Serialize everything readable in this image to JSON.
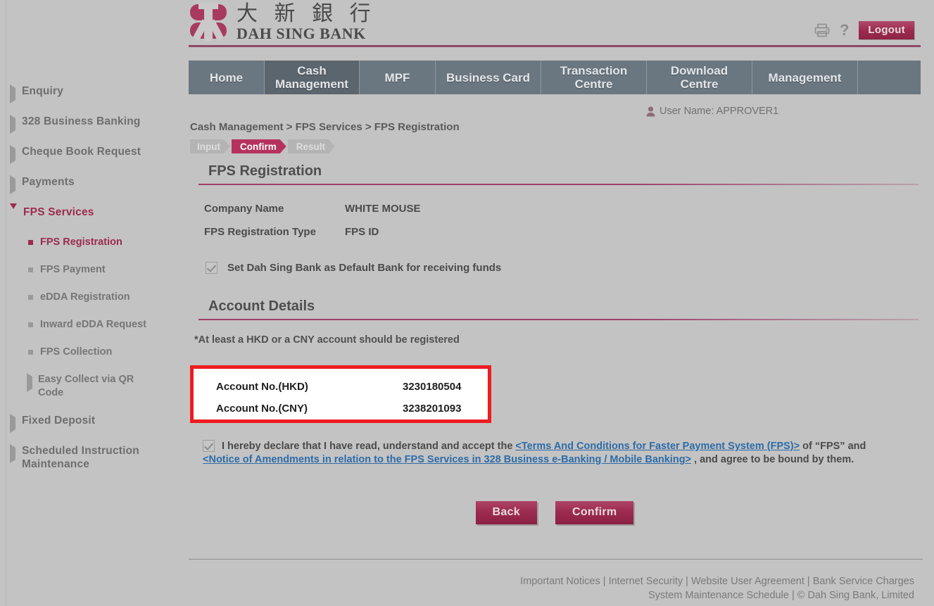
{
  "brand": {
    "name_cn": "大 新 銀 行",
    "name_en": "DAH SING BANK",
    "accent": "#9c2b4e",
    "logo_icon": "dah-sing-bank-logo"
  },
  "header": {
    "print_icon": "printer-icon",
    "help_icon": "question-mark-icon",
    "logout_label": "Logout"
  },
  "nav": {
    "tabs": [
      {
        "label": "Home",
        "active": false
      },
      {
        "label": "Cash Management",
        "active": true
      },
      {
        "label": "MPF",
        "active": false
      },
      {
        "label": "Business Card",
        "active": false
      },
      {
        "label": "Transaction Centre",
        "active": false
      },
      {
        "label": "Download Centre",
        "active": false
      },
      {
        "label": "Management",
        "active": false
      }
    ]
  },
  "user": {
    "icon": "user-icon",
    "label": "User Name: APPROVER1"
  },
  "sidebar": {
    "items": [
      {
        "label": "Enquiry",
        "level": "top",
        "expanded": false
      },
      {
        "label": "328 Business Banking",
        "level": "top",
        "expanded": false
      },
      {
        "label": "Cheque Book Request",
        "level": "top",
        "expanded": false
      },
      {
        "label": "Payments",
        "level": "top",
        "expanded": false
      },
      {
        "label": "FPS Services",
        "level": "top",
        "expanded": true
      },
      {
        "label": "FPS Registration",
        "level": "sub",
        "active": true
      },
      {
        "label": "FPS Payment",
        "level": "sub",
        "active": false
      },
      {
        "label": "eDDA Registration",
        "level": "sub",
        "active": false
      },
      {
        "label": "Inward eDDA Request",
        "level": "sub",
        "active": false
      },
      {
        "label": "FPS Collection",
        "level": "sub",
        "active": false
      },
      {
        "label": "Easy Collect via QR Code",
        "level": "sub-arrow",
        "active": false
      },
      {
        "label": "Fixed Deposit",
        "level": "top",
        "expanded": false
      },
      {
        "label": "Scheduled Instruction Maintenance",
        "level": "top",
        "expanded": false
      }
    ]
  },
  "breadcrumb": "Cash Management > FPS Services > FPS Registration",
  "steps": [
    {
      "label": "Input",
      "active": false
    },
    {
      "label": "Confirm",
      "active": true
    },
    {
      "label": "Result",
      "active": false
    }
  ],
  "main": {
    "section1_title": "FPS Registration",
    "fields": [
      {
        "label": "Company Name",
        "value": "WHITE MOUSE"
      },
      {
        "label": "FPS Registration Type",
        "value": "FPS ID"
      }
    ],
    "default_bank": {
      "checked": true,
      "label": "Set Dah Sing Bank as Default Bank for receiving funds"
    },
    "section2_title": "Account Details",
    "account_note": "*At least a HKD or a CNY account should be registered",
    "accounts": [
      {
        "label": "Account No.(HKD)",
        "value": "3230180504"
      },
      {
        "label": "Account No.(CNY)",
        "value": "3238201093"
      }
    ],
    "highlight_color": "#ee1c22",
    "declaration": {
      "checked": true,
      "text_1": "I hereby declare that I have read, understand and accept the ",
      "link_1": "<Terms And Conditions for Faster Payment System (FPS)>",
      "text_2": " of “FPS” and ",
      "link_2": "<Notice of Amendments in relation to the FPS Services in 328 Business e-Banking / Mobile Banking>",
      "text_3": " , and agree to be bound by them."
    },
    "buttons": {
      "back": "Back",
      "confirm": "Confirm"
    }
  },
  "footer": {
    "line1": [
      "Important Notices",
      "Internet Security",
      "Website User Agreement",
      "Bank Service Charges"
    ],
    "line2": [
      "System Maintenance Schedule",
      "© Dah Sing Bank, Limited"
    ],
    "separator": " | "
  }
}
